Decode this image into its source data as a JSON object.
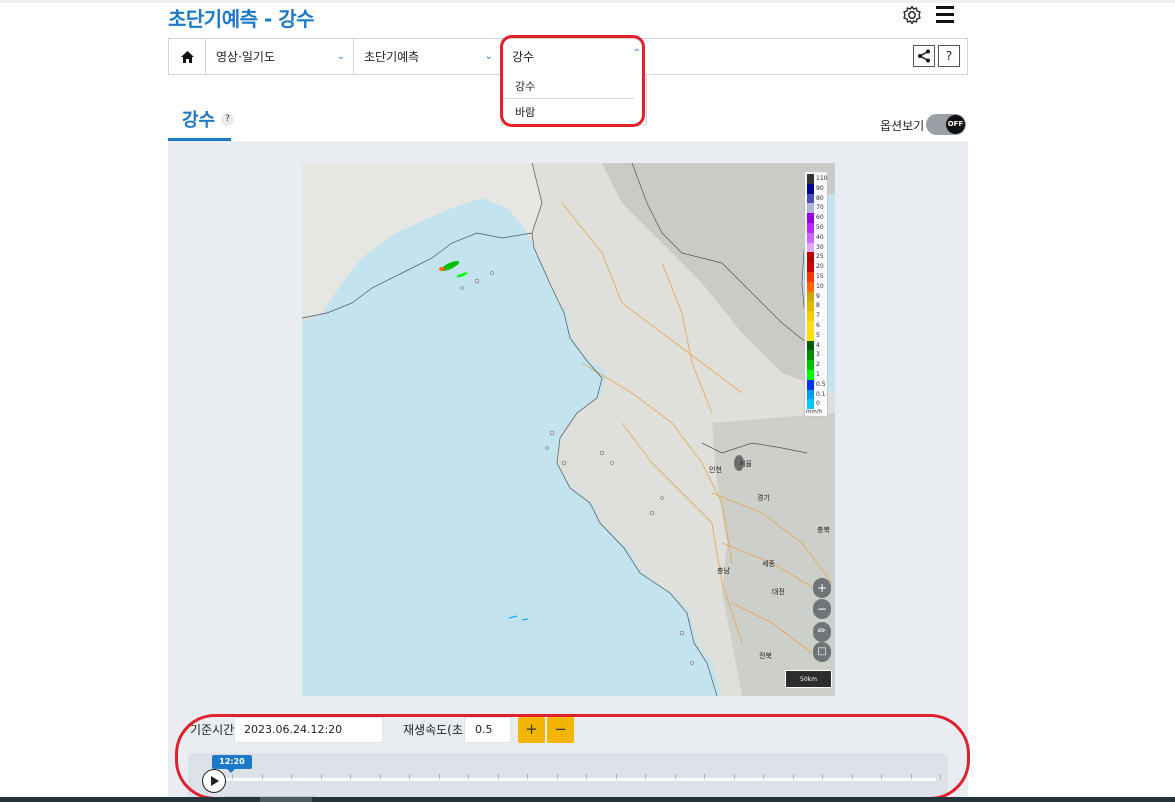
{
  "header": {
    "title": "초단기예측 - 강수"
  },
  "breadcrumb": {
    "items": [
      {
        "label": "영상·일기도"
      },
      {
        "label": "초단기예측"
      },
      {
        "label": "강수"
      }
    ],
    "help_label": "?"
  },
  "dropdown": {
    "options": [
      "강수",
      "바람"
    ]
  },
  "section": {
    "tab_label": "강수",
    "help": "?",
    "option_label": "옵션보기",
    "toggle_state": "OFF"
  },
  "legend": {
    "unit": "mm/h",
    "levels": [
      {
        "label": "110",
        "color": "#333333"
      },
      {
        "label": "90",
        "color": "#000390"
      },
      {
        "label": "80",
        "color": "#4c4eb1"
      },
      {
        "label": "70",
        "color": "#b3b4de"
      },
      {
        "label": "60",
        "color": "#9300e4"
      },
      {
        "label": "50",
        "color": "#b329ff"
      },
      {
        "label": "40",
        "color": "#c969ff"
      },
      {
        "label": "30",
        "color": "#e0a9ff"
      },
      {
        "label": "25",
        "color": "#b40000"
      },
      {
        "label": "20",
        "color": "#d20000"
      },
      {
        "label": "15",
        "color": "#ff3200"
      },
      {
        "label": "10",
        "color": "#ff6600"
      },
      {
        "label": "9",
        "color": "#ccaa00"
      },
      {
        "label": "8",
        "color": "#e0b900"
      },
      {
        "label": "7",
        "color": "#f9cd00"
      },
      {
        "label": "6",
        "color": "#ffdc1f"
      },
      {
        "label": "5",
        "color": "#ffe100"
      },
      {
        "label": "4",
        "color": "#005a00"
      },
      {
        "label": "3",
        "color": "#008c00"
      },
      {
        "label": "2",
        "color": "#00be00"
      },
      {
        "label": "1",
        "color": "#00ff00"
      },
      {
        "label": "0.5",
        "color": "#0033f5"
      },
      {
        "label": "0.1",
        "color": "#009bf5"
      },
      {
        "label": "0",
        "color": "#00c8ff"
      }
    ]
  },
  "map": {
    "labels": [
      "인천",
      "서울",
      "경기",
      "충북",
      "충남",
      "세종",
      "대전",
      "전북"
    ],
    "scale_label": "50km"
  },
  "controls": {
    "base_time_label": "기준시간",
    "base_time_value": "2023.06.24.12:20",
    "speed_label": "재생속도(초)",
    "speed_value": "0.5",
    "plus_label": "+",
    "minus_label": "−",
    "timeline_current": "12:20"
  },
  "colors": {
    "accent": "#1b79c8",
    "highlight": "#e0202a",
    "button": "#f2b600"
  }
}
